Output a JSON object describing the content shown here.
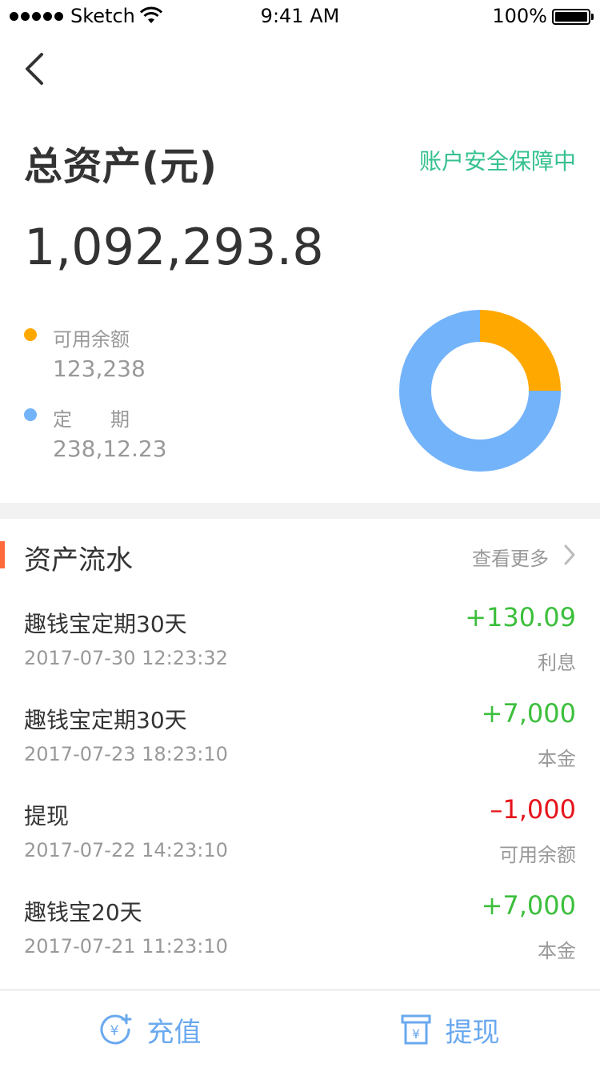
{
  "status_bar": {
    "carrier": "Sketch",
    "time": "9:41 AM",
    "battery": "100%"
  },
  "header": {
    "back_icon": "chevron-left-icon"
  },
  "summary": {
    "title": "总资产(元)",
    "security_text": "账户安全保障中",
    "total_value": "1,092,293.8",
    "legend": [
      {
        "label": "可用余额",
        "value": "123,238",
        "color": "#ffa800"
      },
      {
        "label": "定　　期",
        "value": "238,12.23",
        "color": "#73b3fa"
      }
    ]
  },
  "chart_data": {
    "type": "pie",
    "style": "donut",
    "categories": [
      "可用余额",
      "定　　期"
    ],
    "values": [
      0.25,
      0.75
    ],
    "colors": [
      "#ffa800",
      "#73b3fa"
    ]
  },
  "flow": {
    "title": "资产流水",
    "more_label": "查看更多",
    "items": [
      {
        "name": "趣钱宝定期30天",
        "time": "2017-07-30 12:23:32",
        "amount": "+130.09",
        "type": "利息",
        "amount_color": "#3cbf3c"
      },
      {
        "name": "趣钱宝定期30天",
        "time": "2017-07-23 18:23:10",
        "amount": "+7,000",
        "type": "本金",
        "amount_color": "#3cbf3c"
      },
      {
        "name": "提现",
        "time": "2017-07-22 14:23:10",
        "amount": "–1,000",
        "type": "可用余额",
        "amount_color": "#e5151b"
      },
      {
        "name": "趣钱宝20天",
        "time": "2017-07-21 11:23:10",
        "amount": "+7,000",
        "type": "本金",
        "amount_color": "#3cbf3c"
      }
    ]
  },
  "bottom_bar": {
    "recharge_label": "充值",
    "withdraw_label": "提现",
    "recharge_icon": "yen-plus-icon",
    "withdraw_icon": "yen-box-icon",
    "accent_color": "#6aa9ef"
  }
}
